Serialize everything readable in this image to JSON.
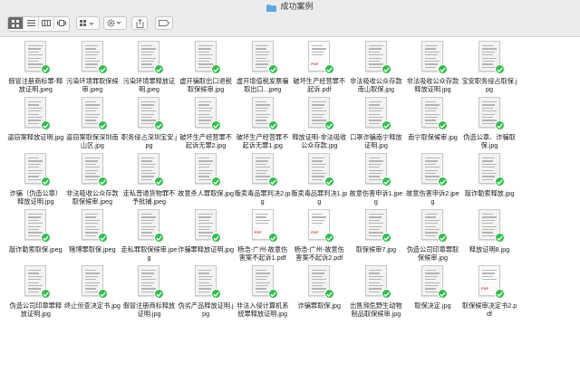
{
  "window": {
    "title": "成功案例"
  },
  "toolbar": {
    "view_buttons": [
      "icon-view",
      "list-view",
      "column-view",
      "gallery-view"
    ],
    "group_icon": "group-icon",
    "action_icon": "gear-icon",
    "share_icon": "share-icon",
    "tag_icon": "tag-icon"
  },
  "colors": {
    "badge": "#2fbf4a",
    "folder": "#5aa9e6"
  },
  "files": [
    {
      "name": "假冒注册商标罪-释放证明.jpeg",
      "type": "img"
    },
    {
      "name": "污染环境罪取保候审.jpeg",
      "type": "img"
    },
    {
      "name": "污染环境罪释放证明.jpeg",
      "type": "img"
    },
    {
      "name": "虚开骗取出口退税取保候审.jpg",
      "type": "img"
    },
    {
      "name": "虚开增值税发票骗取出口...jpeg",
      "type": "img"
    },
    {
      "name": "破坏生产经营罪不起诉.pdf",
      "type": "pdf"
    },
    {
      "name": "非法吸收公众存款南山取保.jpg",
      "type": "img"
    },
    {
      "name": "非法吸收公众存款释放证明.jpg",
      "type": "img"
    },
    {
      "name": "宝安职务侵占取保.jpg",
      "type": "img"
    },
    {
      "name": "",
      "type": "none"
    },
    {
      "name": "盗窃案释放证明.jpg",
      "type": "img"
    },
    {
      "name": "盗窃案取保深圳南山区.jpg",
      "type": "img"
    },
    {
      "name": "职务侵占深圳宝安.jpg",
      "type": "img"
    },
    {
      "name": "破坏生产经营罪不起诉无罪2.jpg",
      "type": "img"
    },
    {
      "name": "破坏生产经营罪不起诉无罪1.jpg",
      "type": "img"
    },
    {
      "name": "释放证明-非法吸收公众存款.jpg",
      "type": "img"
    },
    {
      "name": "口罩诈骗南宁释放证明.jpg",
      "type": "img"
    },
    {
      "name": "南宁取保候审.jpg",
      "type": "img"
    },
    {
      "name": "伪造公章、诈骗取保.jpg",
      "type": "img"
    },
    {
      "name": "",
      "type": "none"
    },
    {
      "name": "诈骗（伪造公章）释放证明.jpg",
      "type": "img"
    },
    {
      "name": "非法吸收公众存款取保候审.jpeg",
      "type": "img"
    },
    {
      "name": "走私普通货物罪不予批捕.jpeg",
      "type": "img"
    },
    {
      "name": "故意杀人罪取保.jpg",
      "type": "img"
    },
    {
      "name": "贩卖毒品罪判决2.jpg",
      "type": "img"
    },
    {
      "name": "贩卖毒品罪判决1.jpg",
      "type": "img"
    },
    {
      "name": "故意伤害申诉1.jpeg",
      "type": "img"
    },
    {
      "name": "故意伤害申诉2.jpeg",
      "type": "img"
    },
    {
      "name": "敲诈勒索释放.jpg",
      "type": "img"
    },
    {
      "name": "",
      "type": "none"
    },
    {
      "name": "敲诈勒索取保.jpeg",
      "type": "img"
    },
    {
      "name": "赌博罪取保.jpeg",
      "type": "img"
    },
    {
      "name": "走私罪取保候审.jpeg",
      "type": "img"
    },
    {
      "name": "诈骗罪释放证明.jpg",
      "type": "img"
    },
    {
      "name": "杨浩-广州-故意伤害案不起诉1.pdf",
      "type": "pdf"
    },
    {
      "name": "杨浩-广州-故意伤害案不起诉2.pdf",
      "type": "pdf"
    },
    {
      "name": "取保候审7.jpg",
      "type": "img"
    },
    {
      "name": "伪造公司印章罪取保候审.jpg",
      "type": "img"
    },
    {
      "name": "释放证明8.jpg",
      "type": "img"
    },
    {
      "name": "",
      "type": "none"
    },
    {
      "name": "伪造公司印章罪释放证明.jpg",
      "type": "img"
    },
    {
      "name": "终止侦查决定书.jpg",
      "type": "img"
    },
    {
      "name": "假冒注册商标释放证明.jpg",
      "type": "img"
    },
    {
      "name": "伪劣产品释放证明.jpg",
      "type": "img"
    },
    {
      "name": "非法入侵计算机系统罪释放证明.jpg",
      "type": "img"
    },
    {
      "name": "诈骗罪取保.jpg",
      "type": "img"
    },
    {
      "name": "出售濒危野生动物制品取保候审.jpg",
      "type": "img"
    },
    {
      "name": "取保决定.jpg",
      "type": "img"
    },
    {
      "name": "取保候审决定书2.pdf",
      "type": "pdf"
    },
    {
      "name": "",
      "type": "none"
    }
  ]
}
